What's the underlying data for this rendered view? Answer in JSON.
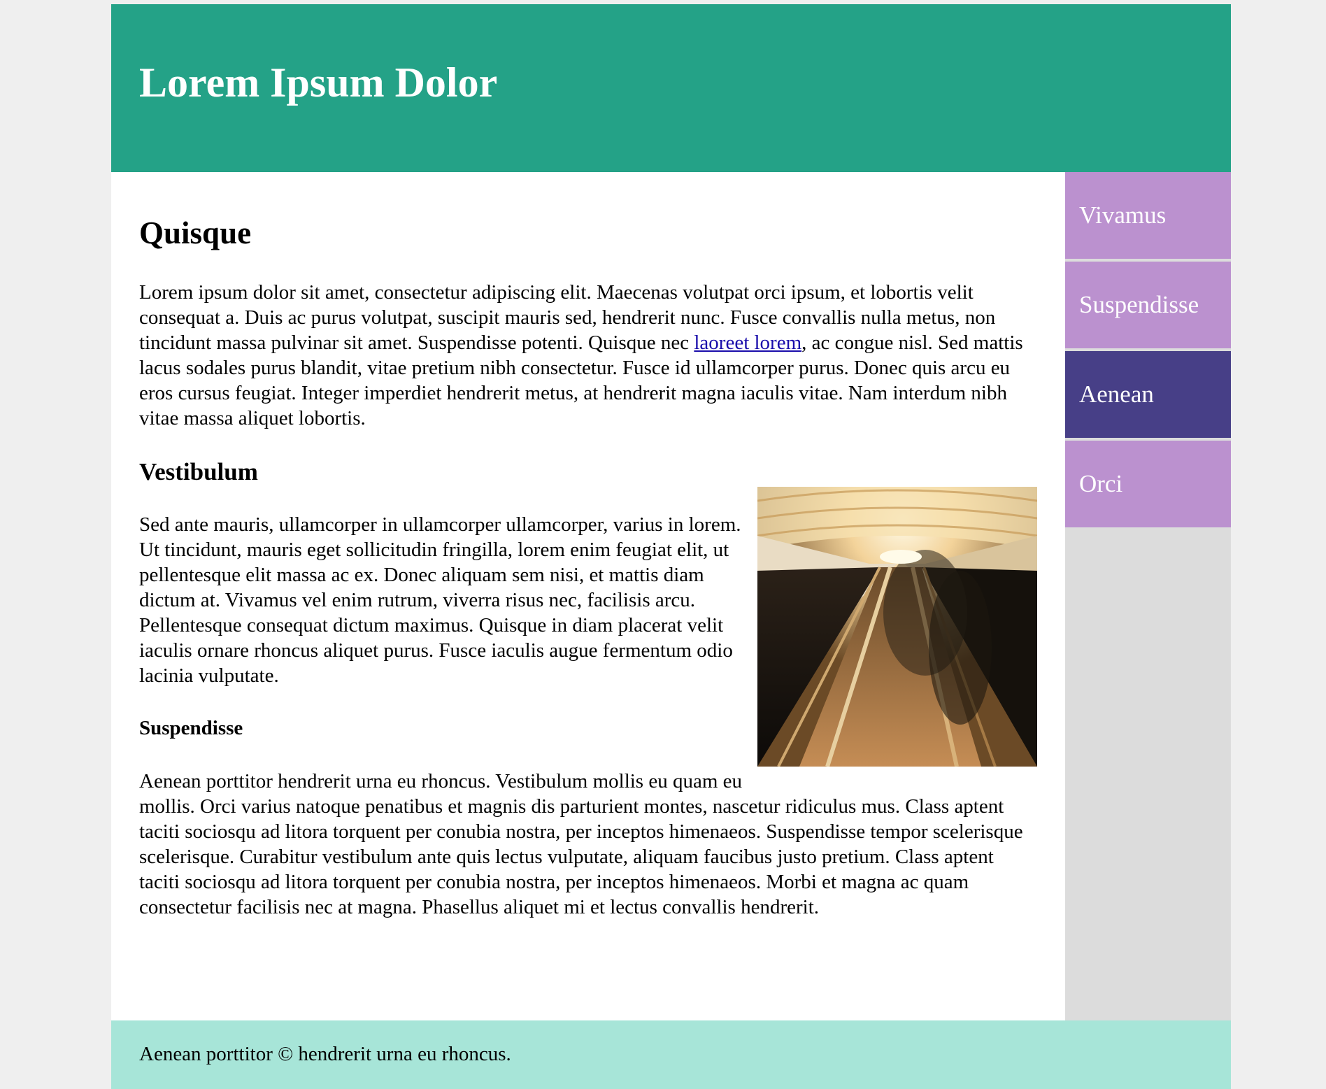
{
  "header": {
    "title": "Lorem Ipsum Dolor"
  },
  "main": {
    "heading": "Quisque",
    "intro": {
      "before_link": "Lorem ipsum dolor sit amet, consectetur adipiscing elit. Maecenas volutpat orci ipsum, et lobortis velit consequat a. Duis ac purus volutpat, suscipit mauris sed, hendrerit nunc. Fusce convallis nulla metus, non tincidunt massa pulvinar sit amet. Suspendisse potenti. Quisque nec ",
      "link_text": "laoreet lorem",
      "after_link": ", ac congue nisl. Sed mattis lacus sodales purus blandit, vitae pretium nibh consectetur. Fusce id ullamcorper purus. Donec quis arcu eu eros cursus feugiat. Integer imperdiet hendrerit metus, at hendrerit magna iaculis vitae. Nam interdum nibh vitae massa aliquet lobortis."
    },
    "subheading": "Vestibulum",
    "image_icon": "escalator-photo",
    "paragraph2": "Sed ante mauris, ullamcorper in ullamcorper ullamcorper, varius in lorem. Ut tincidunt, mauris eget sollicitudin fringilla, lorem enim feugiat elit, ut pellentesque elit massa ac ex. Donec aliquam sem nisi, et mattis diam dictum at. Vivamus vel enim rutrum, viverra risus nec, facilisis arcu. Pellentesque consequat dictum maximus. Quisque in diam placerat velit iaculis ornare rhoncus aliquet purus. Fusce iaculis augue fermentum odio lacinia vulputate.",
    "subsubheading": "Suspendisse",
    "paragraph3": "Aenean porttitor hendrerit urna eu rhoncus. Vestibulum mollis eu quam eu mollis. Orci varius natoque penatibus et magnis dis parturient montes, nascetur ridiculus mus. Class aptent taciti sociosqu ad litora torquent per conubia nostra, per inceptos himenaeos. Suspendisse tempor scelerisque scelerisque. Curabitur vestibulum ante quis lectus vulputate, aliquam faucibus justo pretium. Class aptent taciti sociosqu ad litora torquent per conubia nostra, per inceptos himenaeos. Morbi et magna ac quam consectetur facilisis nec at magna. Phasellus aliquet mi et lectus convallis hendrerit."
  },
  "sidebar": {
    "items": [
      {
        "label": "Vivamus",
        "active": false
      },
      {
        "label": "Suspendisse",
        "active": false
      },
      {
        "label": "Aenean",
        "active": true
      },
      {
        "label": "Orci",
        "active": false
      }
    ]
  },
  "footer": {
    "text": "Aenean porttitor © hendrerit urna eu rhoncus."
  },
  "colors": {
    "header_bg": "#24a287",
    "nav_item_bg": "#bb91cf",
    "nav_active_bg": "#473f87",
    "sidebar_bg": "#dcdcdc",
    "footer_bg": "#a7e5d8",
    "page_bg": "#efefef",
    "link": "#1a0dab"
  }
}
